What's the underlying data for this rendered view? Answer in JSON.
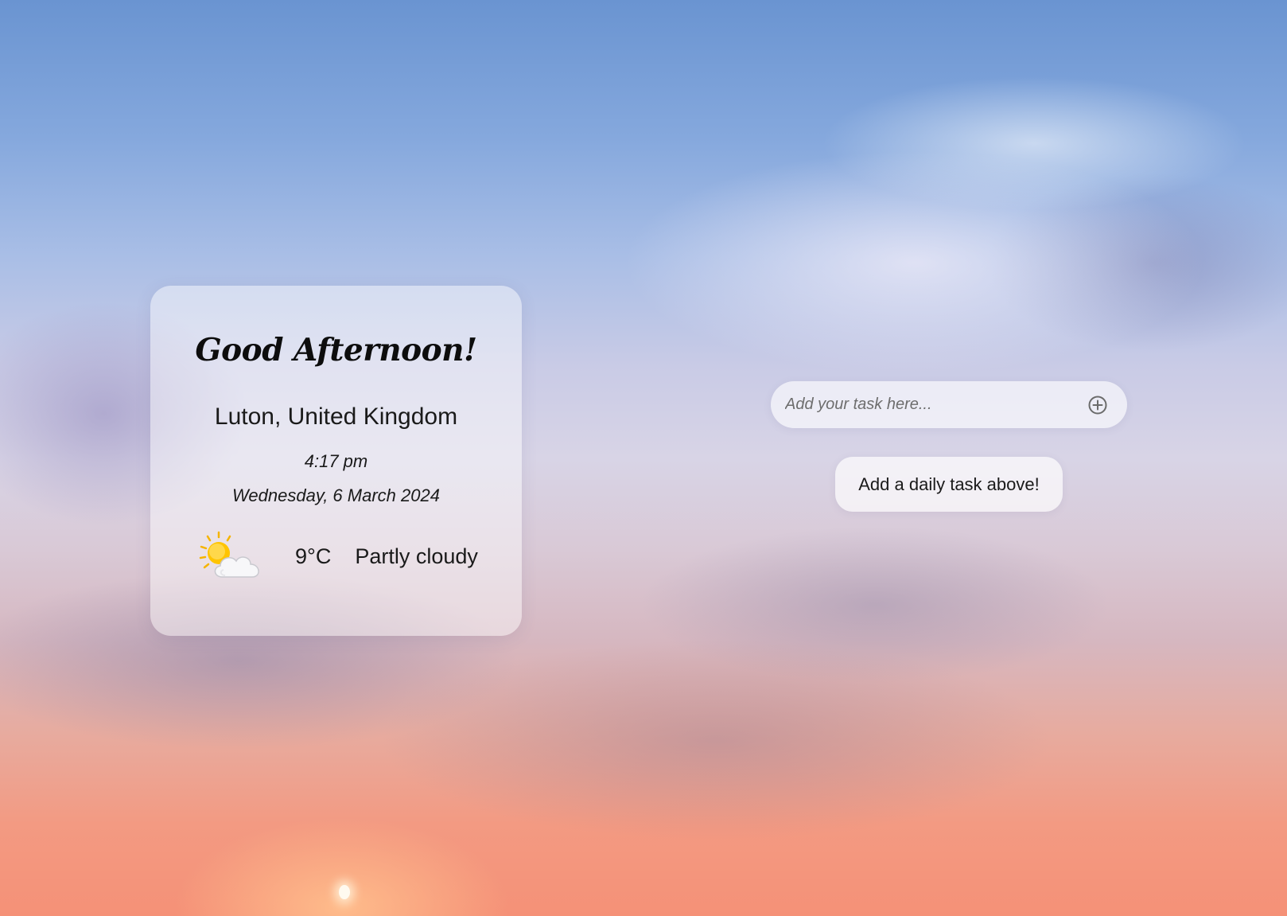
{
  "greeting": "Good Afternoon!",
  "location": "Luton, United Kingdom",
  "time": "4:17 pm",
  "date": "Wednesday, 6 March 2024",
  "weather": {
    "icon": "partly-cloudy-icon",
    "temperature": "9°C",
    "condition": "Partly cloudy"
  },
  "tasks": {
    "input_value": "",
    "input_placeholder": "Add your task here...",
    "add_icon": "plus-circle-icon",
    "empty_message": "Add a daily task above!"
  },
  "colors": {
    "sky_top": "#6a94d1",
    "sky_bottom": "#f59177",
    "card_background": "rgba(255,255,255,0.45)",
    "text": "#111111"
  }
}
